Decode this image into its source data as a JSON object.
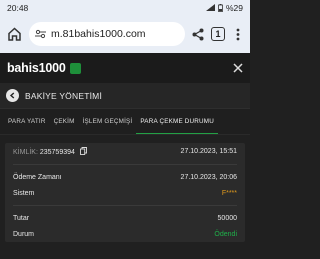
{
  "status_bar": {
    "time": "20:48",
    "battery": "%29"
  },
  "browser": {
    "url": "m.81bahis1000.com",
    "tab_count": "1"
  },
  "site": {
    "logo_text": "bahis1000"
  },
  "page": {
    "title": "BAKİYE YÖNETİMİ"
  },
  "tabs": [
    {
      "label": "PARA YATIR",
      "active": false
    },
    {
      "label": "ÇEKİM",
      "active": false
    },
    {
      "label": "İŞLEM GEÇMİŞİ",
      "active": false
    },
    {
      "label": "PARA ÇEKME DURUMU",
      "active": true
    }
  ],
  "transaction": {
    "id_label": "KİMLİK:",
    "id_value": "235759394",
    "created_at": "27.10.2023, 15:51",
    "payment_time_label": "Ödeme Zamanı",
    "payment_time": "27.10.2023, 20:06",
    "system_label": "Sistem",
    "system_value": "F****",
    "amount_label": "Tutar",
    "amount_value": "50000",
    "status_label": "Durum",
    "status_value": "Ödendi"
  },
  "colors": {
    "accent": "#23a045",
    "paid": "#1fb04a",
    "system": "#e29b1d"
  }
}
